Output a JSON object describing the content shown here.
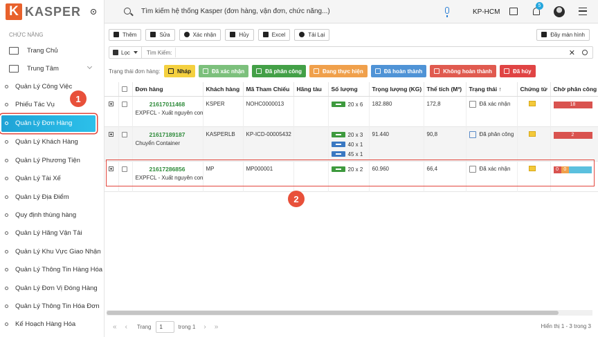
{
  "app": {
    "brand_letter": "K",
    "brand_name": "KASPER"
  },
  "sidebar": {
    "section_label": "CHỨC NĂNG",
    "top_items": [
      {
        "label": "Trang Chủ",
        "icon": "monitor-icon"
      },
      {
        "label": "Trung Tâm",
        "icon": "download-screen-icon"
      }
    ],
    "items": [
      {
        "label": "Quản Lý Công Việc"
      },
      {
        "label": "Phiếu Tác Vụ"
      },
      {
        "label": "Quản Lý Đơn Hàng"
      },
      {
        "label": "Quản Lý Khách Hàng"
      },
      {
        "label": "Quản Lý Phương Tiện"
      },
      {
        "label": "Quản Lý Tài Xế"
      },
      {
        "label": "Quản Lý Địa Điểm"
      },
      {
        "label": "Quy định thùng hàng"
      },
      {
        "label": "Quản Lý Hãng Vận Tải"
      },
      {
        "label": "Quản Lý Khu Vực Giao Nhận"
      },
      {
        "label": "Quản Lý Thông Tin Hàng Hóa"
      },
      {
        "label": "Quản Lý Đơn Vị Đóng Hàng"
      },
      {
        "label": "Quản Lý Thông Tin Hóa Đơn"
      },
      {
        "label": "Kế Hoạch Hàng Hóa"
      }
    ],
    "active_index": 2
  },
  "callouts": {
    "first": "1",
    "second": "2"
  },
  "topbar": {
    "search_placeholder": "Tìm kiếm hệ thống Kasper (đơn hàng, vận đơn, chức năng...)",
    "branch": "KP-HCM",
    "notification_count": "5"
  },
  "toolbar": {
    "buttons": [
      "Thêm",
      "Sửa",
      "Xác nhận",
      "Hủy",
      "Excel",
      "Tải Lại"
    ],
    "fullscreen": "Đầy màn hình"
  },
  "filter": {
    "loc_label": "Lọc",
    "search_label": "Tìm Kiếm:",
    "search_value": ""
  },
  "status_filter": {
    "label": "Trạng thái đơn hàng:",
    "chips": [
      {
        "label": "Nháp",
        "color": "#f4d03f"
      },
      {
        "label": "Đã xác nhận",
        "color": "#7cc07c"
      },
      {
        "label": "Đã phân công",
        "color": "#43a047"
      },
      {
        "label": "Đang thực hiện",
        "color": "#f0a04b"
      },
      {
        "label": "Đã hoàn thành",
        "color": "#4f93d6"
      },
      {
        "label": "Không hoàn thành",
        "color": "#e05a4f"
      },
      {
        "label": "Đã hủy",
        "color": "#e04444"
      }
    ]
  },
  "table": {
    "columns": [
      "",
      "",
      "Đơn hàng",
      "Khách hàng",
      "Mã Tham Chiếu",
      "Hãng tàu",
      "Số lượng",
      "Trọng lượng (KG)",
      "Thể tích (M³)",
      "Trạng thái ↑",
      "Chứng từ",
      "Chờ phân công"
    ],
    "rows": [
      {
        "order_no": "21617011468",
        "order_sub": "EXPFCL - Xuất nguyên cont",
        "customer": "KSPER",
        "ref": "NOHC0000013",
        "carrier": "",
        "qty": [
          "20 x 6"
        ],
        "weight": "182.880",
        "volume": "172,8",
        "status": "Đã xác nhận",
        "pending_segments": [
          {
            "label": "18",
            "color": "#d9534f"
          }
        ]
      },
      {
        "order_no": "21617189187",
        "order_sub": "Chuyển Container",
        "customer": "KASPERLB",
        "ref": "KP-ICD-00005432",
        "carrier": "",
        "qty": [
          "20 x 3",
          "40 x 1",
          "45 x 1"
        ],
        "weight": "91.440",
        "volume": "90,8",
        "status": "Đã phân công",
        "pending_segments": [
          {
            "label": "2",
            "color": "#d9534f"
          }
        ]
      },
      {
        "order_no": "21617286856",
        "order_sub": "EXPFCL - Xuất nguyên cont",
        "customer": "MP",
        "ref": "MP000001",
        "carrier": "",
        "qty": [
          "20 x 2"
        ],
        "weight": "60.960",
        "volume": "66,4",
        "status": "Đã xác nhận",
        "pending_segments": [
          {
            "label": "0",
            "color": "#d9534f"
          },
          {
            "label": "0",
            "color": "#f0a04b"
          },
          {
            "label": "",
            "color": "#5bc0de"
          }
        ]
      }
    ]
  },
  "pagination": {
    "page_label": "Trang",
    "page_value": "1",
    "of_label": "trong 1",
    "info": "Hiển thị 1 - 3 trong 3"
  }
}
